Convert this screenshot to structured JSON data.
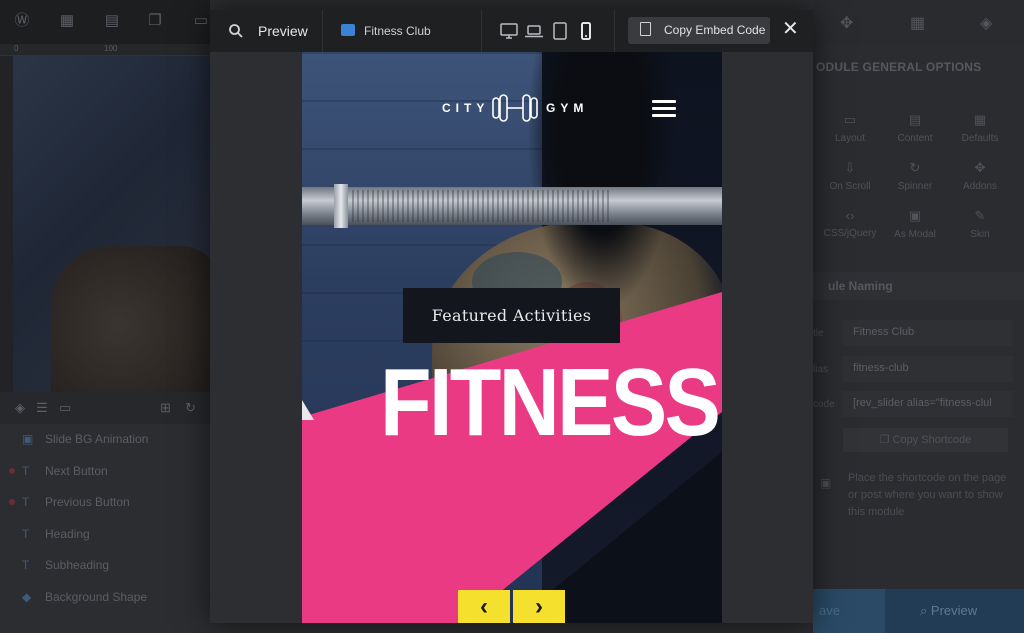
{
  "editor": {
    "layers": [
      {
        "label": "Slide BG Animation",
        "icon": "image-icon",
        "dot": false
      },
      {
        "label": "Next Button",
        "icon": "text-icon",
        "dot": true
      },
      {
        "label": "Previous Button",
        "icon": "text-icon",
        "dot": true
      },
      {
        "label": "Heading",
        "icon": "text-icon",
        "dot": false
      },
      {
        "label": "Subheading",
        "icon": "text-icon",
        "dot": false
      },
      {
        "label": "Background Shape",
        "icon": "shape-icon",
        "dot": false
      }
    ]
  },
  "right_panel": {
    "title": "ODULE GENERAL OPTIONS",
    "options": [
      {
        "label": "Layout",
        "icon": "layout-icon"
      },
      {
        "label": "Content",
        "icon": "content-icon"
      },
      {
        "label": "Defaults",
        "icon": "defaults-icon"
      },
      {
        "label": "On Scroll",
        "icon": "scroll-icon"
      },
      {
        "label": "Spinner",
        "icon": "spinner-icon"
      },
      {
        "label": "Addons",
        "icon": "addons-icon"
      },
      {
        "label": "CSS/jQuery",
        "icon": "code-icon"
      },
      {
        "label": "As Modal",
        "icon": "modal-icon"
      },
      {
        "label": "Skin",
        "icon": "skin-icon"
      }
    ],
    "section_title": "ule Naming",
    "fields": [
      {
        "label": "tle",
        "value": "Fitness Club"
      },
      {
        "label": "lias",
        "value": "fitness-club"
      },
      {
        "label": "code",
        "value": "[rev_slider alias=\"fitness-clul"
      }
    ],
    "copy_shortcode": "Copy Shortcode",
    "note": "Place the shortcode on the page or post where you want to show this module",
    "save_label": "ave",
    "preview_label": "Preview"
  },
  "modal": {
    "preview_label": "Preview",
    "slider_name": "Fitness Club",
    "devices": [
      "desktop-icon",
      "laptop-icon",
      "tablet-icon",
      "phone-icon"
    ],
    "active_device": "phone-icon",
    "embed_label": "Copy Embed Code"
  },
  "slide": {
    "logo_left": "CITY",
    "logo_right": "GYM",
    "featured": "Featured Activities",
    "heading": "FITNESS",
    "prev_arrow": "‹",
    "next_arrow": "›",
    "colors": {
      "accent_pink": "#ea3a84",
      "button_yellow": "#f5e12d",
      "caption_bg": "#14161d"
    }
  }
}
